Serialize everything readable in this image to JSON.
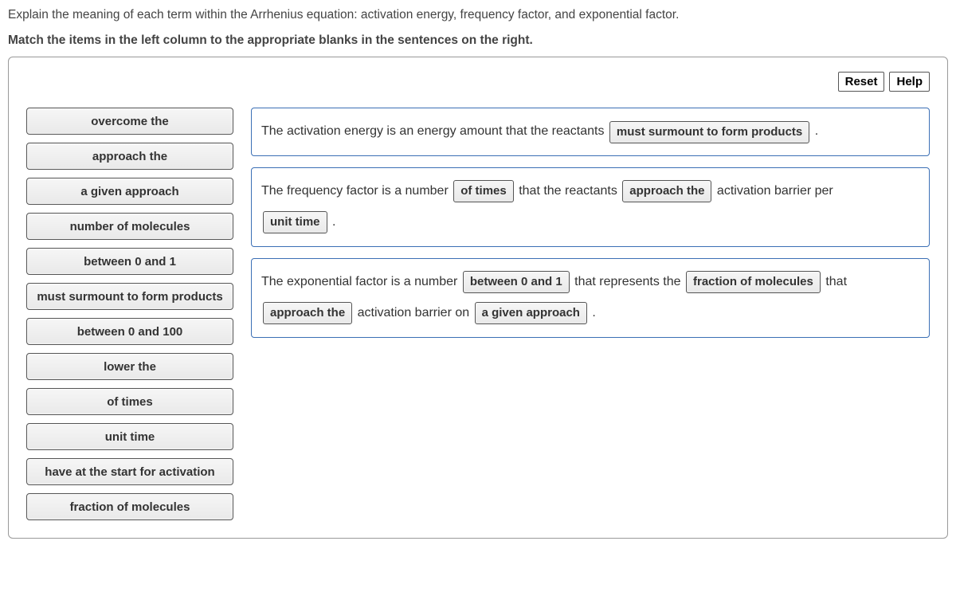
{
  "prompt": {
    "line1": "Explain the meaning of each term within the Arrhenius equation: activation energy, frequency factor, and exponential factor.",
    "line2": "Match the items in the left column to the appropriate blanks in the sentences on the right."
  },
  "buttons": {
    "reset": "Reset",
    "help": "Help"
  },
  "dragItems": [
    "overcome the",
    "approach the",
    "a given approach",
    "number of molecules",
    "between 0 and 1",
    "must surmount to form products",
    "between 0 and 100",
    "lower the",
    "of times",
    "unit time",
    "have at the start for activation",
    "fraction of molecules"
  ],
  "sentences": {
    "s1": {
      "t1": "The activation energy is an energy amount that the reactants ",
      "b1": "must surmount to form products",
      "t2": " ."
    },
    "s2": {
      "t1": "The frequency factor is a number ",
      "b1": "of times",
      "t2": "  that the reactants ",
      "b2": "approach the",
      "t3": "  activation barrier per ",
      "b3": "unit time",
      "t4": " ."
    },
    "s3": {
      "t1": "The exponential factor is a number ",
      "b1": "between 0 and 1",
      "t2": "  that represents the ",
      "b2": "fraction of molecules",
      "t3": " that ",
      "b3": "approach the",
      "t4": "  activation barrier on ",
      "b4": "a given approach",
      "t5": " ."
    }
  }
}
